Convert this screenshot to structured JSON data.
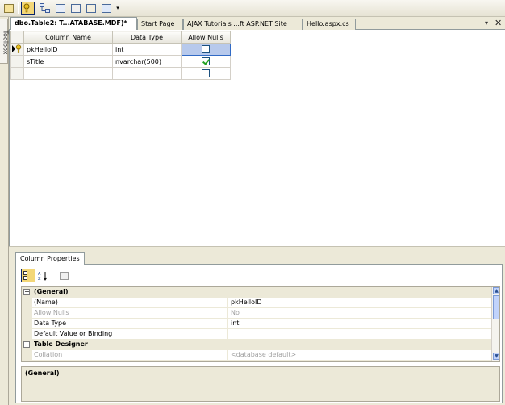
{
  "toolbar": {
    "icons": [
      "designer-icon",
      "set-primary-key-icon",
      "relationships-icon",
      "indexes-icon",
      "fulltext-icon",
      "xml-indexes-icon",
      "check-constraints-icon",
      "generate-script-icon",
      "toolbar-options-icon"
    ]
  },
  "toolbox": {
    "label": "Toolbox"
  },
  "tabs": [
    {
      "label": "dbo.Table2: T...ATABASE.MDF)*",
      "active": true
    },
    {
      "label": "Start Page",
      "active": false
    },
    {
      "label": "AJAX Tutorials ...ft ASP.NET Site",
      "active": false
    },
    {
      "label": "Hello.aspx.cs",
      "active": false
    }
  ],
  "tab_controls": {
    "menu": "▾",
    "close": "✕"
  },
  "table_designer": {
    "headers": {
      "column_name": "Column Name",
      "data_type": "Data Type",
      "allow_nulls": "Allow Nulls"
    },
    "rows": [
      {
        "column_name": "pkHelloID",
        "data_type": "int",
        "allow_nulls": false,
        "primary_key": true,
        "selected": true
      },
      {
        "column_name": "sTitle",
        "data_type": "nvarchar(500)",
        "allow_nulls": true,
        "primary_key": false,
        "selected": false
      },
      {
        "column_name": "",
        "data_type": "",
        "allow_nulls": false,
        "primary_key": false,
        "selected": false
      }
    ]
  },
  "column_properties": {
    "tab_label": "Column Properties",
    "rows": [
      {
        "type": "category",
        "toggle": "⊟",
        "name": "(General)"
      },
      {
        "type": "prop",
        "name": "(Name)",
        "value": "pkHelloID",
        "dim": false
      },
      {
        "type": "prop",
        "name": "Allow Nulls",
        "value": "No",
        "dim": true
      },
      {
        "type": "prop",
        "name": "Data Type",
        "value": "int",
        "dim": false
      },
      {
        "type": "prop",
        "name": "Default Value or Binding",
        "value": "",
        "dim": false
      },
      {
        "type": "category",
        "toggle": "⊟",
        "name": "Table Designer"
      },
      {
        "type": "prop",
        "name": "Collation",
        "value": "<database default>",
        "dim": true
      }
    ],
    "description_title": "(General)"
  }
}
